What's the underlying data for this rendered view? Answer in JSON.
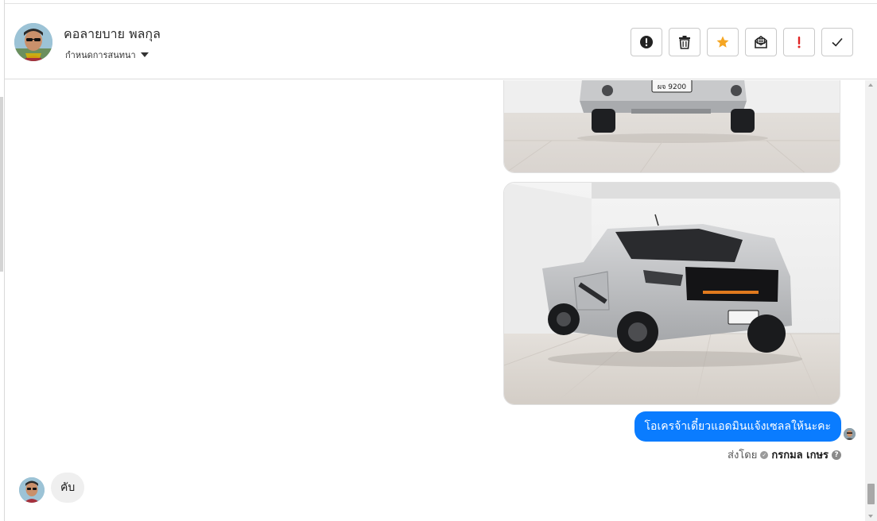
{
  "header": {
    "contact_name": "คอลายบาย พลกุล",
    "assign_label": "กำหนดการสนทนา",
    "actions": [
      {
        "icon": "alert-circle-icon"
      },
      {
        "icon": "trash-icon"
      },
      {
        "icon": "star-icon",
        "color": "#f5a623"
      },
      {
        "icon": "mark-unread-icon"
      },
      {
        "icon": "exclamation-icon",
        "color": "#e02424"
      },
      {
        "icon": "check-icon"
      }
    ]
  },
  "messages": {
    "outgoing_text": "โอเครจ้าเดี๋ยวแอดมินแจ้งเซลลให้นะคะ",
    "sent_by_label": "ส่งโดย",
    "agent_name": "กรกมล เกษร",
    "help_symbol": "?",
    "incoming_text": "คับ"
  },
  "photos": {
    "plate_text": "ผจ 9200"
  },
  "colors": {
    "accent": "#0a7cff",
    "incoming_bubble": "#efefef",
    "star": "#f5a623",
    "alert": "#e02424"
  }
}
